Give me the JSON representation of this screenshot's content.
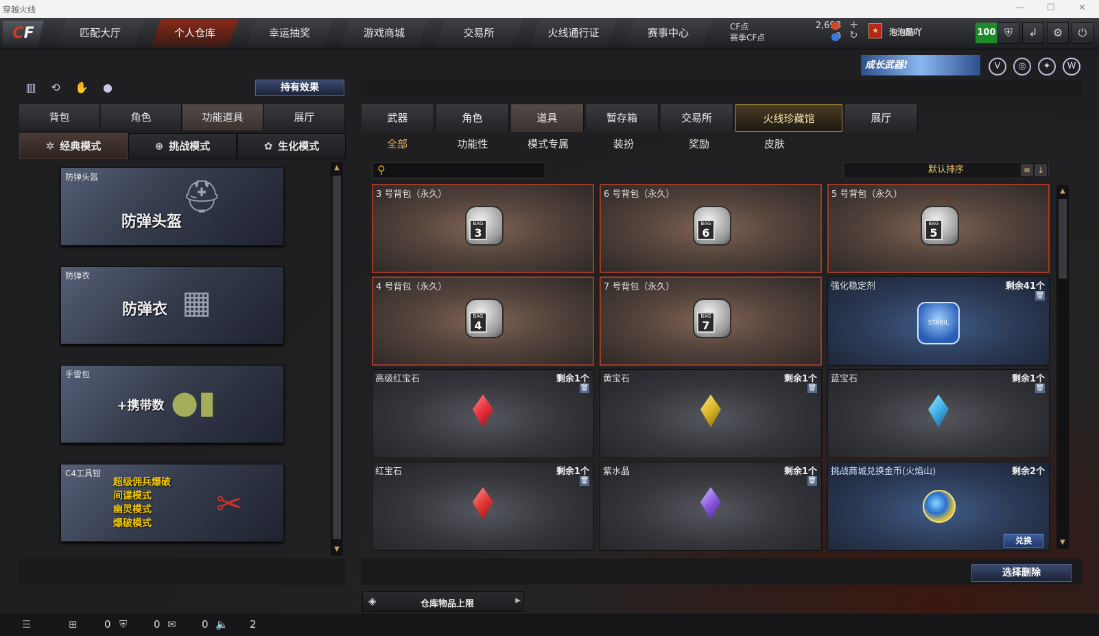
{
  "window": {
    "title": "穿越火线"
  },
  "nav": {
    "logo": "CF",
    "tabs": [
      {
        "label": "匹配大厅"
      },
      {
        "label": "个人仓库",
        "active": true
      },
      {
        "label": "幸运抽奖"
      },
      {
        "label": "游戏商城"
      },
      {
        "label": "交易所"
      },
      {
        "label": "火线通行证"
      },
      {
        "label": "赛事中心"
      }
    ]
  },
  "currency": {
    "cf_label": "CF点",
    "cf_value": "2,698",
    "match_label": "赛季CF点",
    "match_value": "0",
    "add_icon": "plus-icon",
    "refresh_icon": "refresh-icon"
  },
  "user": {
    "name": "泡泡酷吖",
    "level": "100"
  },
  "banner": {
    "text": "成长武器!"
  },
  "left": {
    "effect_button": "持有效果",
    "tabs": [
      {
        "label": "背包"
      },
      {
        "label": "角色"
      },
      {
        "label": "功能道具",
        "active": true
      },
      {
        "label": "展厅"
      }
    ],
    "modes": [
      {
        "label": "经典模式",
        "active": true
      },
      {
        "label": "挑战模式"
      },
      {
        "label": "生化模式"
      }
    ],
    "cards": [
      {
        "caption": "防弹头盔",
        "title": "防弹头盔"
      },
      {
        "caption": "防弹衣",
        "title": "防弹衣"
      },
      {
        "caption": "手雷包",
        "title": "+携带数"
      },
      {
        "caption": "C4工具钳",
        "lines": [
          "超级佣兵爆破",
          "间谍模式",
          "幽灵模式",
          "爆破模式"
        ]
      }
    ]
  },
  "right": {
    "tabs": [
      {
        "label": "武器"
      },
      {
        "label": "角色"
      },
      {
        "label": "道具",
        "active": true
      },
      {
        "label": "暂存箱"
      },
      {
        "label": "交易所"
      },
      {
        "label": "火线珍藏馆",
        "highlight": true
      },
      {
        "label": "展厅"
      }
    ],
    "subtabs": [
      {
        "label": "全部",
        "active": true
      },
      {
        "label": "功能性"
      },
      {
        "label": "模式专属"
      },
      {
        "label": "装扮"
      },
      {
        "label": "奖励"
      },
      {
        "label": "皮肤"
      }
    ],
    "search_placeholder": "",
    "sort_label": "默认排序",
    "items": [
      {
        "name": "3 号背包（永久）",
        "type": "bag",
        "num": "3"
      },
      {
        "name": "6 号背包（永久）",
        "type": "bag",
        "num": "6"
      },
      {
        "name": "5 号背包（永久）",
        "type": "bag",
        "num": "5"
      },
      {
        "name": "4 号背包（永久）",
        "type": "bag",
        "num": "4"
      },
      {
        "name": "7 号背包（永久）",
        "type": "bag",
        "num": "7"
      },
      {
        "name": "强化稳定剂",
        "type": "gem",
        "count": "剩余41个",
        "color": "#3a7bd5"
      },
      {
        "name": "高级红宝石",
        "type": "gem",
        "count": "剩余1个",
        "color": "#e8303a"
      },
      {
        "name": "黄宝石",
        "type": "gem",
        "count": "剩余1个",
        "color": "#d9b526"
      },
      {
        "name": "蓝宝石",
        "type": "gem",
        "count": "剩余1个",
        "color": "#3fb0e8"
      },
      {
        "name": "红宝石",
        "type": "gem",
        "count": "剩余1个",
        "color": "#e23636"
      },
      {
        "name": "紫水晶",
        "type": "gem",
        "count": "剩余1个",
        "color": "#8a5ae0"
      },
      {
        "name": "挑战商城兑换金币(火焰山)",
        "type": "coin",
        "count": "剩余2个",
        "action": "兑换"
      }
    ],
    "delete_button": "选择删除",
    "capacity_label": "仓库物品上限"
  },
  "bottom": {
    "values": [
      "0",
      "0",
      "0",
      "2"
    ]
  }
}
